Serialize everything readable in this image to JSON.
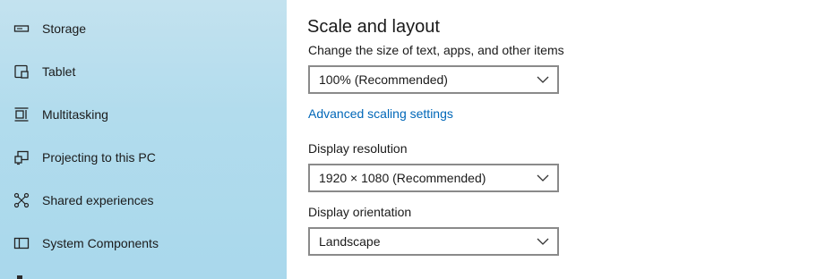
{
  "sidebar": {
    "items": [
      {
        "label": "Storage",
        "icon": "storage-icon"
      },
      {
        "label": "Tablet",
        "icon": "tablet-icon"
      },
      {
        "label": "Multitasking",
        "icon": "multitasking-icon"
      },
      {
        "label": "Projecting to this PC",
        "icon": "projecting-icon"
      },
      {
        "label": "Shared experiences",
        "icon": "shared-experiences-icon"
      },
      {
        "label": "System Components",
        "icon": "system-components-icon"
      }
    ]
  },
  "main": {
    "section_title": "Scale and layout",
    "scale": {
      "label": "Change the size of text, apps, and other items",
      "value": "100% (Recommended)"
    },
    "advanced_link": "Advanced scaling settings",
    "resolution": {
      "label": "Display resolution",
      "value": "1920 × 1080 (Recommended)"
    },
    "orientation": {
      "label": "Display orientation",
      "value": "Landscape"
    }
  },
  "colors": {
    "sidebar_background": "#b2dced",
    "link": "#0067b8",
    "dropdown_border": "#8a8a8a"
  }
}
